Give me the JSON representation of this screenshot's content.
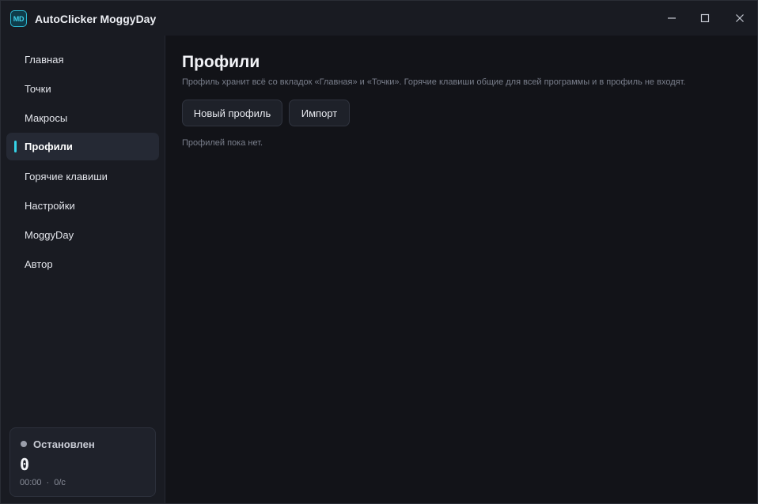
{
  "window": {
    "title": "AutoClicker MoggyDay",
    "logo_text": "MD"
  },
  "sidebar": {
    "items": [
      {
        "label": "Главная",
        "active": false
      },
      {
        "label": "Точки",
        "active": false
      },
      {
        "label": "Макросы",
        "active": false
      },
      {
        "label": "Профили",
        "active": true
      },
      {
        "label": "Горячие клавиши",
        "active": false
      },
      {
        "label": "Настройки",
        "active": false
      },
      {
        "label": "MoggyDay",
        "active": false
      },
      {
        "label": "Автор",
        "active": false
      }
    ],
    "status": {
      "label": "Остановлен",
      "count": "0",
      "time": "00:00",
      "separator": "·",
      "rate": "0/с"
    }
  },
  "main": {
    "title": "Профили",
    "description": "Профиль хранит всё со вкладок «Главная» и «Точки». Горячие клавиши общие для всей программы и в профиль не входят.",
    "new_profile_label": "Новый профиль",
    "import_label": "Импорт",
    "empty_text": "Профилей пока нет."
  },
  "colors": {
    "accent": "#35d3e8",
    "sidebar_bg": "#191b22",
    "main_bg": "#121318",
    "status_dot": "#9a9eaa"
  },
  "icons": {
    "minimize": "minimize-icon",
    "maximize": "maximize-icon",
    "close": "close-icon"
  }
}
